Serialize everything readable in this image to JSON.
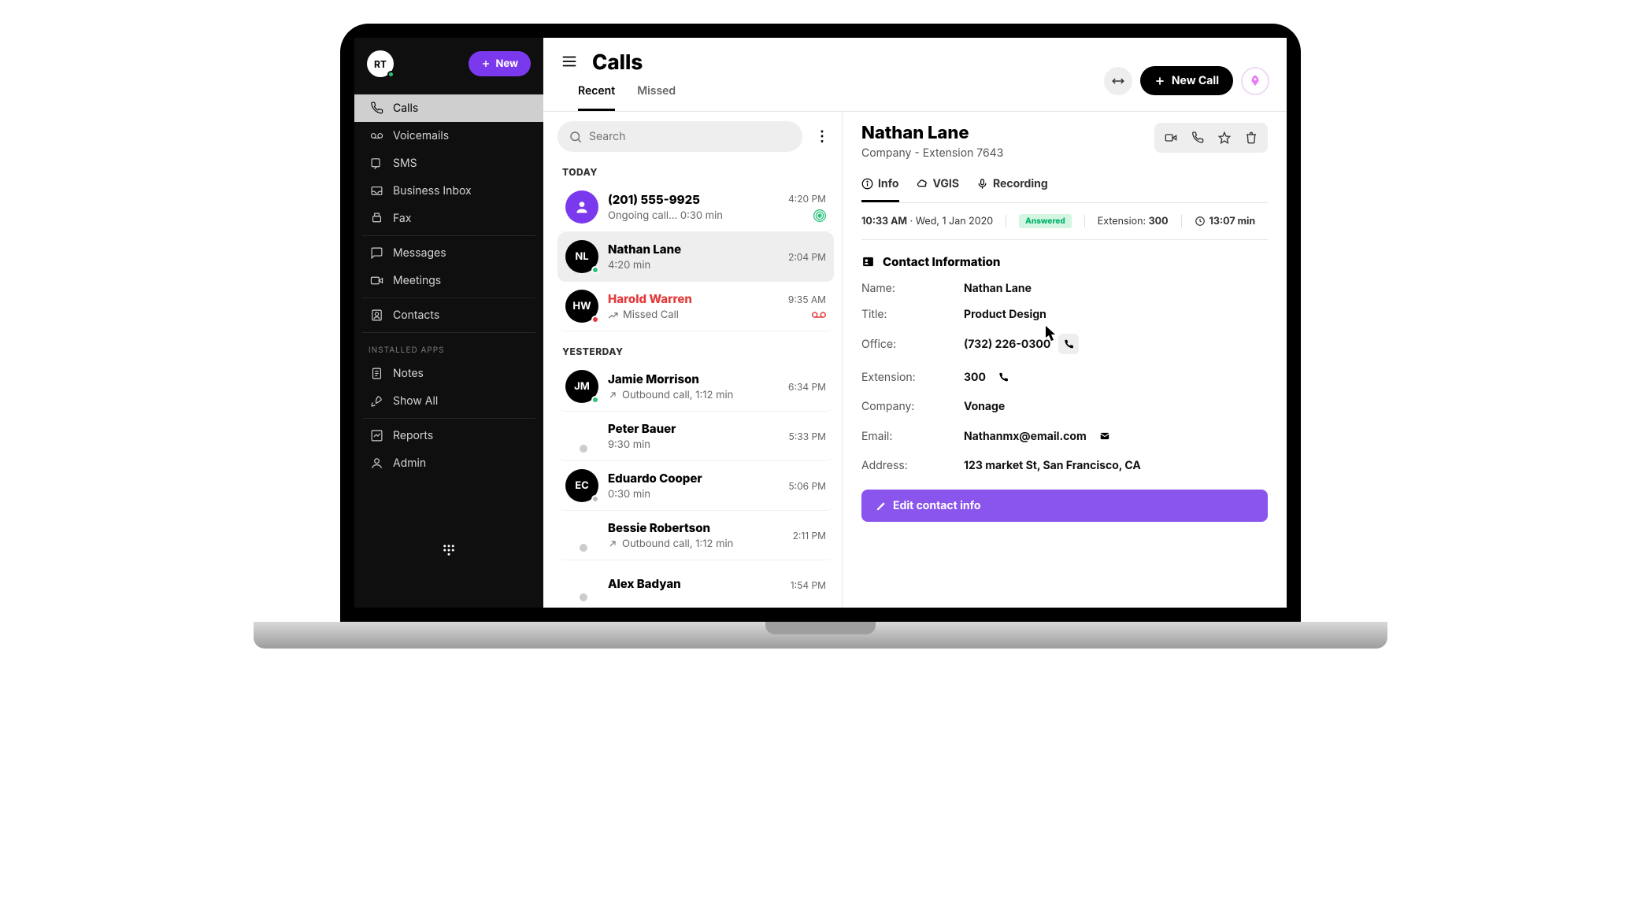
{
  "user": {
    "initials": "RT"
  },
  "sidebar": {
    "new_label": "New",
    "installed_apps_label": "INSTALLED APPS",
    "items": [
      {
        "key": "calls",
        "label": "Calls",
        "active": true
      },
      {
        "key": "voicemails",
        "label": "Voicemails"
      },
      {
        "key": "sms",
        "label": "SMS"
      },
      {
        "key": "business-inbox",
        "label": "Business Inbox"
      },
      {
        "key": "fax",
        "label": "Fax"
      }
    ],
    "items2": [
      {
        "key": "messages",
        "label": "Messages"
      },
      {
        "key": "meetings",
        "label": "Meetings"
      }
    ],
    "items3": [
      {
        "key": "contacts",
        "label": "Contacts"
      }
    ],
    "apps": [
      {
        "key": "notes",
        "label": "Notes"
      },
      {
        "key": "show-all",
        "label": "Show All"
      }
    ],
    "items4": [
      {
        "key": "reports",
        "label": "Reports"
      },
      {
        "key": "admin",
        "label": "Admin"
      }
    ]
  },
  "header": {
    "title": "Calls",
    "new_call": "New Call"
  },
  "tabs": {
    "recent": "Recent",
    "missed": "Missed",
    "active": "recent"
  },
  "search": {
    "placeholder": "Search"
  },
  "sections": {
    "today": "TODAY",
    "yesterday": "YESTERDAY"
  },
  "calls": {
    "today": [
      {
        "avatar_type": "purple",
        "avatar": "",
        "name": "(201) 555-9925",
        "sub": "Ongoing call... 0:30 min",
        "time": "4:20 PM",
        "ongoing": true
      },
      {
        "avatar_type": "black",
        "avatar": "NL",
        "name": "Nathan Lane",
        "sub": "4:20 min",
        "time": "2:04 PM",
        "presence": "green",
        "selected": true
      },
      {
        "avatar_type": "black",
        "avatar": "HW",
        "name": "Harold Warren",
        "sub": "Missed Call",
        "time": "9:35 AM",
        "presence": "red",
        "missed": true,
        "voicemail": true
      }
    ],
    "yesterday": [
      {
        "avatar_type": "black",
        "avatar": "JM",
        "name": "Jamie Morrison",
        "sub": "Outbound call, 1:12 min",
        "time": "6:34 PM",
        "presence": "green",
        "outbound": true
      },
      {
        "avatar_type": "none",
        "avatar": "",
        "name": "Peter Bauer",
        "sub": "9:30 min",
        "time": "5:33 PM"
      },
      {
        "avatar_type": "black",
        "avatar": "EC",
        "name": "Eduardo Cooper",
        "sub": "0:30 min",
        "time": "5:06 PM",
        "presence": "grey"
      },
      {
        "avatar_type": "none",
        "avatar": "",
        "name": "Bessie Robertson",
        "sub": "Outbound call, 1:12 min",
        "time": "2:11 PM",
        "outbound": true
      },
      {
        "avatar_type": "none",
        "avatar": "",
        "name": "Alex Badyan",
        "sub": "",
        "time": "1:54 PM"
      }
    ]
  },
  "detail": {
    "name": "Nathan Lane",
    "company_line": "Company -  Extension 7643",
    "tabs": {
      "info": "Info",
      "vgis": "VGIS",
      "recording": "Recording",
      "active": "info"
    },
    "meta": {
      "time": "10:33 AM",
      "date": "Wed, 1 Jan 2020",
      "status": "Answered",
      "ext_label": "Extension:",
      "ext_value": "300",
      "duration": "13:07 min"
    },
    "ci_header": "Contact Information",
    "fields": {
      "name": {
        "label": "Name:",
        "value": "Nathan Lane"
      },
      "title": {
        "label": "Title:",
        "value": "Product  Design"
      },
      "office": {
        "label": "Office:",
        "value": "(732) 226-0300"
      },
      "extension": {
        "label": "Extension:",
        "value": "300"
      },
      "company": {
        "label": "Company:",
        "value": "Vonage"
      },
      "email": {
        "label": "Email:",
        "value": "Nathanmx@email.com"
      },
      "address": {
        "label": "Address:",
        "value": "123 market St, San Francisco, CA"
      }
    },
    "edit_label": "Edit contact info"
  }
}
